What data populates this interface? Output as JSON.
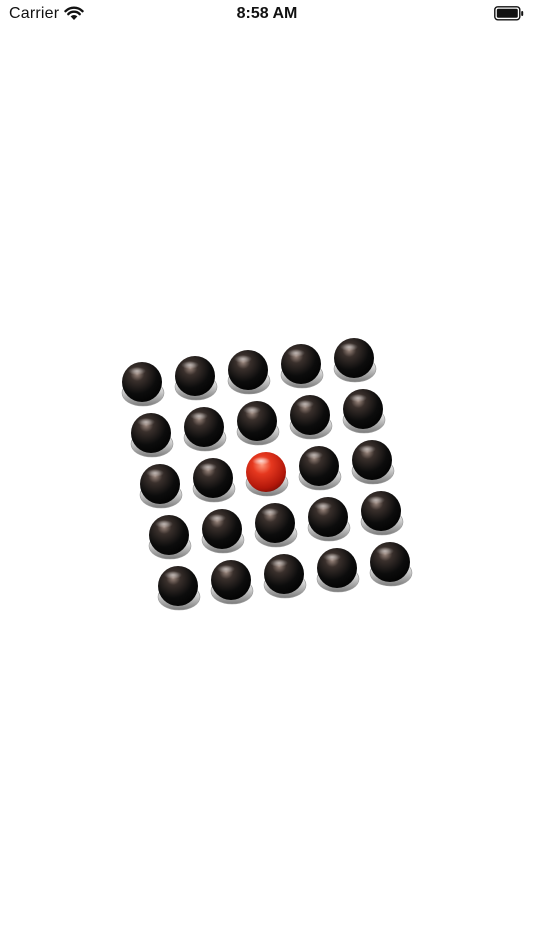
{
  "status_bar": {
    "carrier": "Carrier",
    "time": "8:58 AM",
    "wifi_icon": "wifi-icon",
    "battery_icon": "battery-icon"
  },
  "board": {
    "rows": 5,
    "columns": 5,
    "piece_style": "glossy-sphere-on-silver-base",
    "colors": {
      "black": "#101010",
      "red": "#c8200f",
      "base": "#c9c9c9"
    },
    "grid": [
      [
        "black",
        "black",
        "black",
        "black",
        "black"
      ],
      [
        "black",
        "black",
        "black",
        "black",
        "black"
      ],
      [
        "black",
        "black",
        "red",
        "black",
        "black"
      ],
      [
        "black",
        "black",
        "black",
        "black",
        "black"
      ],
      [
        "black",
        "black",
        "black",
        "black",
        "black"
      ]
    ]
  }
}
